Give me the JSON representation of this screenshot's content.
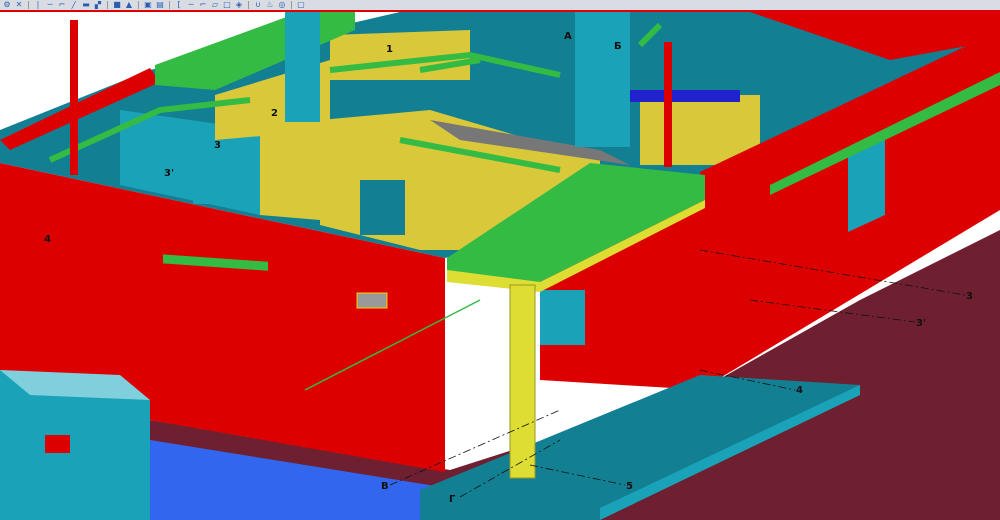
{
  "toolbar": {
    "icons": [
      "filter-icon",
      "snap-icon",
      "column-icon",
      "beam-icon",
      "polybeam-icon",
      "curved-beam-icon",
      "panel-icon",
      "slab-icon",
      "pad-footing-icon",
      "strip-footing-icon",
      "view-icon",
      "view-2-icon",
      "bracket-icon",
      "line-icon",
      "polyline-icon",
      "plane-icon",
      "rectangle-icon",
      "cube-icon",
      "magnet-icon",
      "component-icon",
      "hatch-icon",
      "print-icon"
    ]
  },
  "colors": {
    "brick_red": "#dd0000",
    "teal": "#1aa3b8",
    "canopy_green": "#33bb44",
    "column_yellow": "#dddd33",
    "ground": "#6e1f30",
    "base_blue": "#3366ee",
    "accent_line": "#e00000"
  },
  "grid_labels": {
    "l1": "1",
    "l2": "2",
    "l3": "3",
    "l3p": "3'",
    "l4": "4",
    "lA": "А",
    "lB": "Б",
    "r3": "3",
    "r3p": "3'",
    "r4": "4",
    "r5": "5",
    "lV": "В",
    "lG": "Г"
  }
}
